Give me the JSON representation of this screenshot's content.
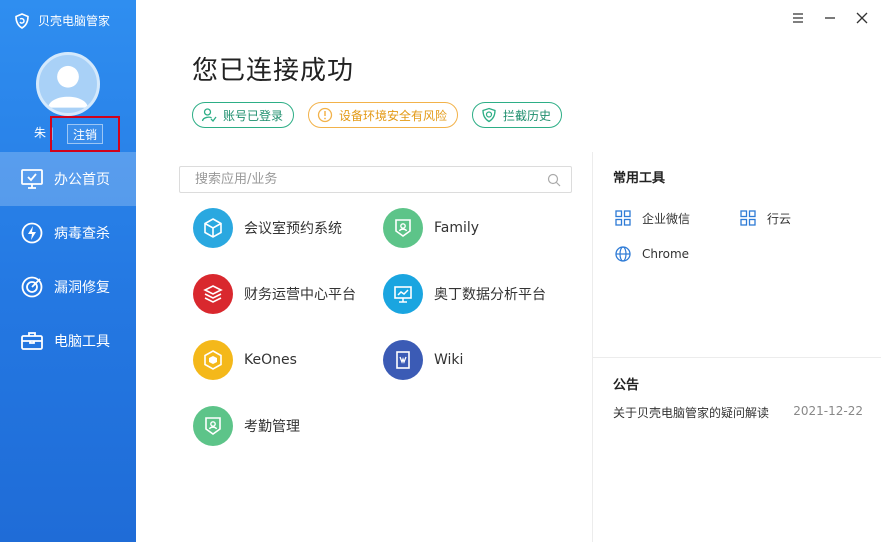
{
  "app": {
    "brand_name": "贝壳电脑管家"
  },
  "user": {
    "name": "朱 |",
    "logout_label": "注销"
  },
  "nav": [
    {
      "label": "办公首页",
      "icon": "monitor-icon",
      "active": true
    },
    {
      "label": "病毒查杀",
      "icon": "lightning-icon",
      "active": false
    },
    {
      "label": "漏洞修复",
      "icon": "target-icon",
      "active": false
    },
    {
      "label": "电脑工具",
      "icon": "toolbox-icon",
      "active": false
    }
  ],
  "main": {
    "title": "您已连接成功",
    "badges": [
      {
        "label": "账号已登录",
        "icon": "user-check-icon",
        "color": "#2dae86"
      },
      {
        "label": "设备环境安全有风险",
        "icon": "warning-icon",
        "color": "#f2b24a"
      },
      {
        "label": "拦截历史",
        "icon": "shield-icon",
        "color": "#2dae86"
      }
    ],
    "search": {
      "placeholder": "搜索应用/业务"
    },
    "apps": [
      {
        "label": "会议室预约系统",
        "icon": "cube-icon",
        "color": "#2aa8e0"
      },
      {
        "label": "Family",
        "icon": "badge-icon",
        "color": "#5dc489"
      },
      {
        "label": "财务运营中心平台",
        "icon": "layers-icon",
        "color": "#d9282e"
      },
      {
        "label": "奥丁数据分析平台",
        "icon": "chart-board-icon",
        "color": "#1aa5e0"
      },
      {
        "label": "KeOnes",
        "icon": "hexagon-icon",
        "color": "#f4b81a"
      },
      {
        "label": "Wiki",
        "icon": "wiki-book-icon",
        "color": "#3b5bb5"
      },
      {
        "label": "考勤管理",
        "icon": "attendance-icon",
        "color": "#5dc489"
      }
    ]
  },
  "tools": {
    "title": "常用工具",
    "items": [
      {
        "label": "企业微信",
        "icon": "grid-icon"
      },
      {
        "label": "行云",
        "icon": "grid-icon"
      },
      {
        "label": "Chrome",
        "icon": "globe-icon"
      }
    ]
  },
  "notice": {
    "title": "公告",
    "items": [
      {
        "text": "关于贝壳电脑管家的疑问解读",
        "date": "2021-12-22"
      }
    ]
  }
}
